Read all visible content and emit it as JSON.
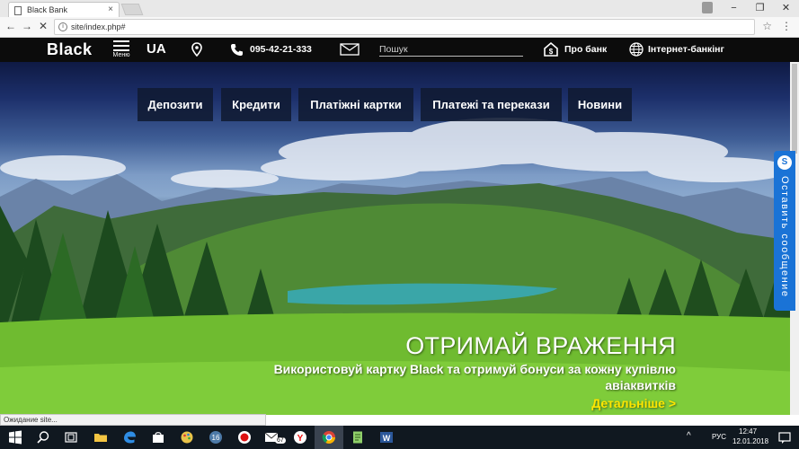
{
  "browser": {
    "tab_title": "Black Bank",
    "url": "site/index.php#",
    "status_text": "Ожидание site..."
  },
  "header": {
    "logo": "Black",
    "menu_label": "Меню",
    "language": "UA",
    "phone": "095-42-21-333",
    "search_placeholder": "Пошук",
    "about_label": "Про банк",
    "ebank_label": "Інтернет-банкінг"
  },
  "categories": [
    "Депозити",
    "Кредити",
    "Платіжні картки",
    "Платежі та перекази",
    "Новини"
  ],
  "hero": {
    "headline": "ОТРИМАЙ ВРАЖЕННЯ",
    "subtext": "Використовуй картку Black та отримуй бонуси за кожну купівлю авіаквитків",
    "more_link": "Детальніше >"
  },
  "feedback": {
    "label": "Оставить сообщение",
    "icon": "S"
  },
  "taskbar": {
    "language": "РУС",
    "time": "12:47",
    "date": "12.01.2018",
    "badge_count": "67"
  },
  "colors": {
    "header_bg": "#0c0c0c",
    "nav_bg": "#101a32",
    "link_yellow": "#ffe600",
    "feedback_blue": "#1a73d6"
  }
}
